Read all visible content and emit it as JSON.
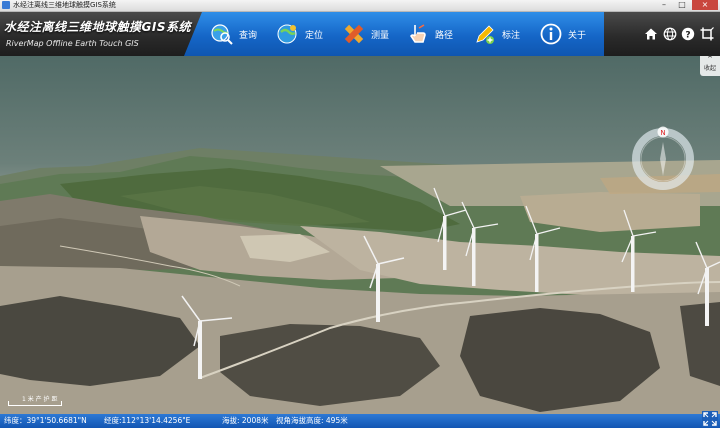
{
  "window": {
    "title": "水经注离线三维地球触摸GIS系统",
    "min": "–",
    "max": "□",
    "close": "×"
  },
  "brand": {
    "title": "水经注离线三维地球触摸GIS系统",
    "subtitle": "RiverMap Offline Earth Touch GIS"
  },
  "nav": [
    {
      "label": "查询",
      "icon": "globe-search-icon"
    },
    {
      "label": "定位",
      "icon": "globe-locate-icon"
    },
    {
      "label": "测量",
      "icon": "ruler-measure-icon"
    },
    {
      "label": "路径",
      "icon": "hand-path-icon"
    },
    {
      "label": "标注",
      "icon": "pencil-mark-icon"
    },
    {
      "label": "关于",
      "icon": "info-icon"
    }
  ],
  "header_controls": [
    "home-icon",
    "globe-icon",
    "help-icon",
    "crop-icon"
  ],
  "collapse": {
    "label": "收起",
    "icon": "chevron-up-icon"
  },
  "compass": {
    "north": "N"
  },
  "scale": {
    "label": "1 米 产 护 距"
  },
  "status": {
    "latitude": "纬度：39°1'50.6681\"N",
    "longitude": "经度:112°13'14.4256\"E",
    "altitude": "海拔: 2008米",
    "view_altitude": "视角海拔高度: 495米"
  },
  "colors": {
    "nav_blue": "#1566c7",
    "header_dark": "#2b2b2b",
    "status_blue": "#1d63c2"
  }
}
